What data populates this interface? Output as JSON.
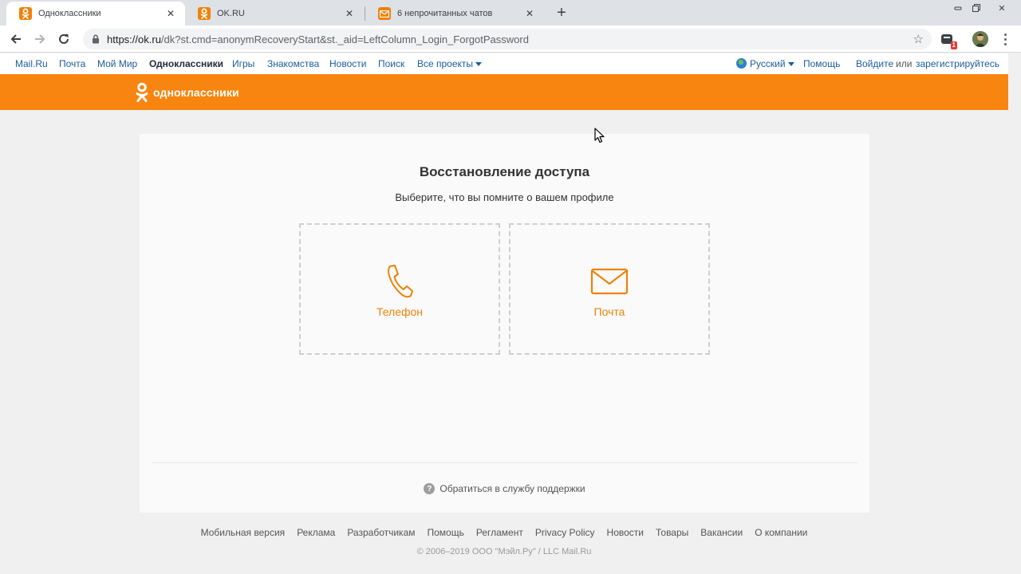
{
  "browser": {
    "tabs": [
      {
        "title": "Одноклассники",
        "favicon": "ok-favicon-icon",
        "active": true
      },
      {
        "title": "OK.RU",
        "favicon": "ok-favicon-icon",
        "active": false
      },
      {
        "title": "6 непрочитанных чатов",
        "favicon": "mail-favicon-icon",
        "active": false
      }
    ],
    "url_host": "https://ok.ru",
    "url_path": "/dk?st.cmd=anonymRecoveryStart&st._aid=LeftColumn_Login_ForgotPassword",
    "extension_badge": "1"
  },
  "projects_bar": {
    "links": [
      "Mail.Ru",
      "Почта",
      "Мой Мир",
      "Одноклассники",
      "Игры",
      "Знакомства",
      "Новости",
      "Поиск",
      "Все проекты"
    ],
    "current": "Одноклассники",
    "language": "Русский",
    "help": "Помощь",
    "login": "Войдите",
    "or": "или",
    "register": "зарегистрируйтесь"
  },
  "header": {
    "logo_text": "одноклассники"
  },
  "recovery": {
    "title": "Восстановление доступа",
    "subtitle": "Выберите, что вы помните о вашем профиле",
    "options": [
      {
        "label": "Телефон",
        "icon": "phone-icon"
      },
      {
        "label": "Почта",
        "icon": "envelope-icon"
      }
    ],
    "support_link": "Обратиться в службу поддержки"
  },
  "footer": {
    "links": [
      "Мобильная версия",
      "Реклама",
      "Разработчикам",
      "Помощь",
      "Регламент",
      "Privacy Policy",
      "Новости",
      "Товары",
      "Вакансии",
      "О компании"
    ],
    "copyright": "© 2006–2019 ООО \"Мэйл.Ру\" / LLC Mail.Ru"
  },
  "colors": {
    "brand_orange": "#f7850f",
    "accent_text": "#ee8208",
    "link_blue": "#1b5c9e"
  }
}
